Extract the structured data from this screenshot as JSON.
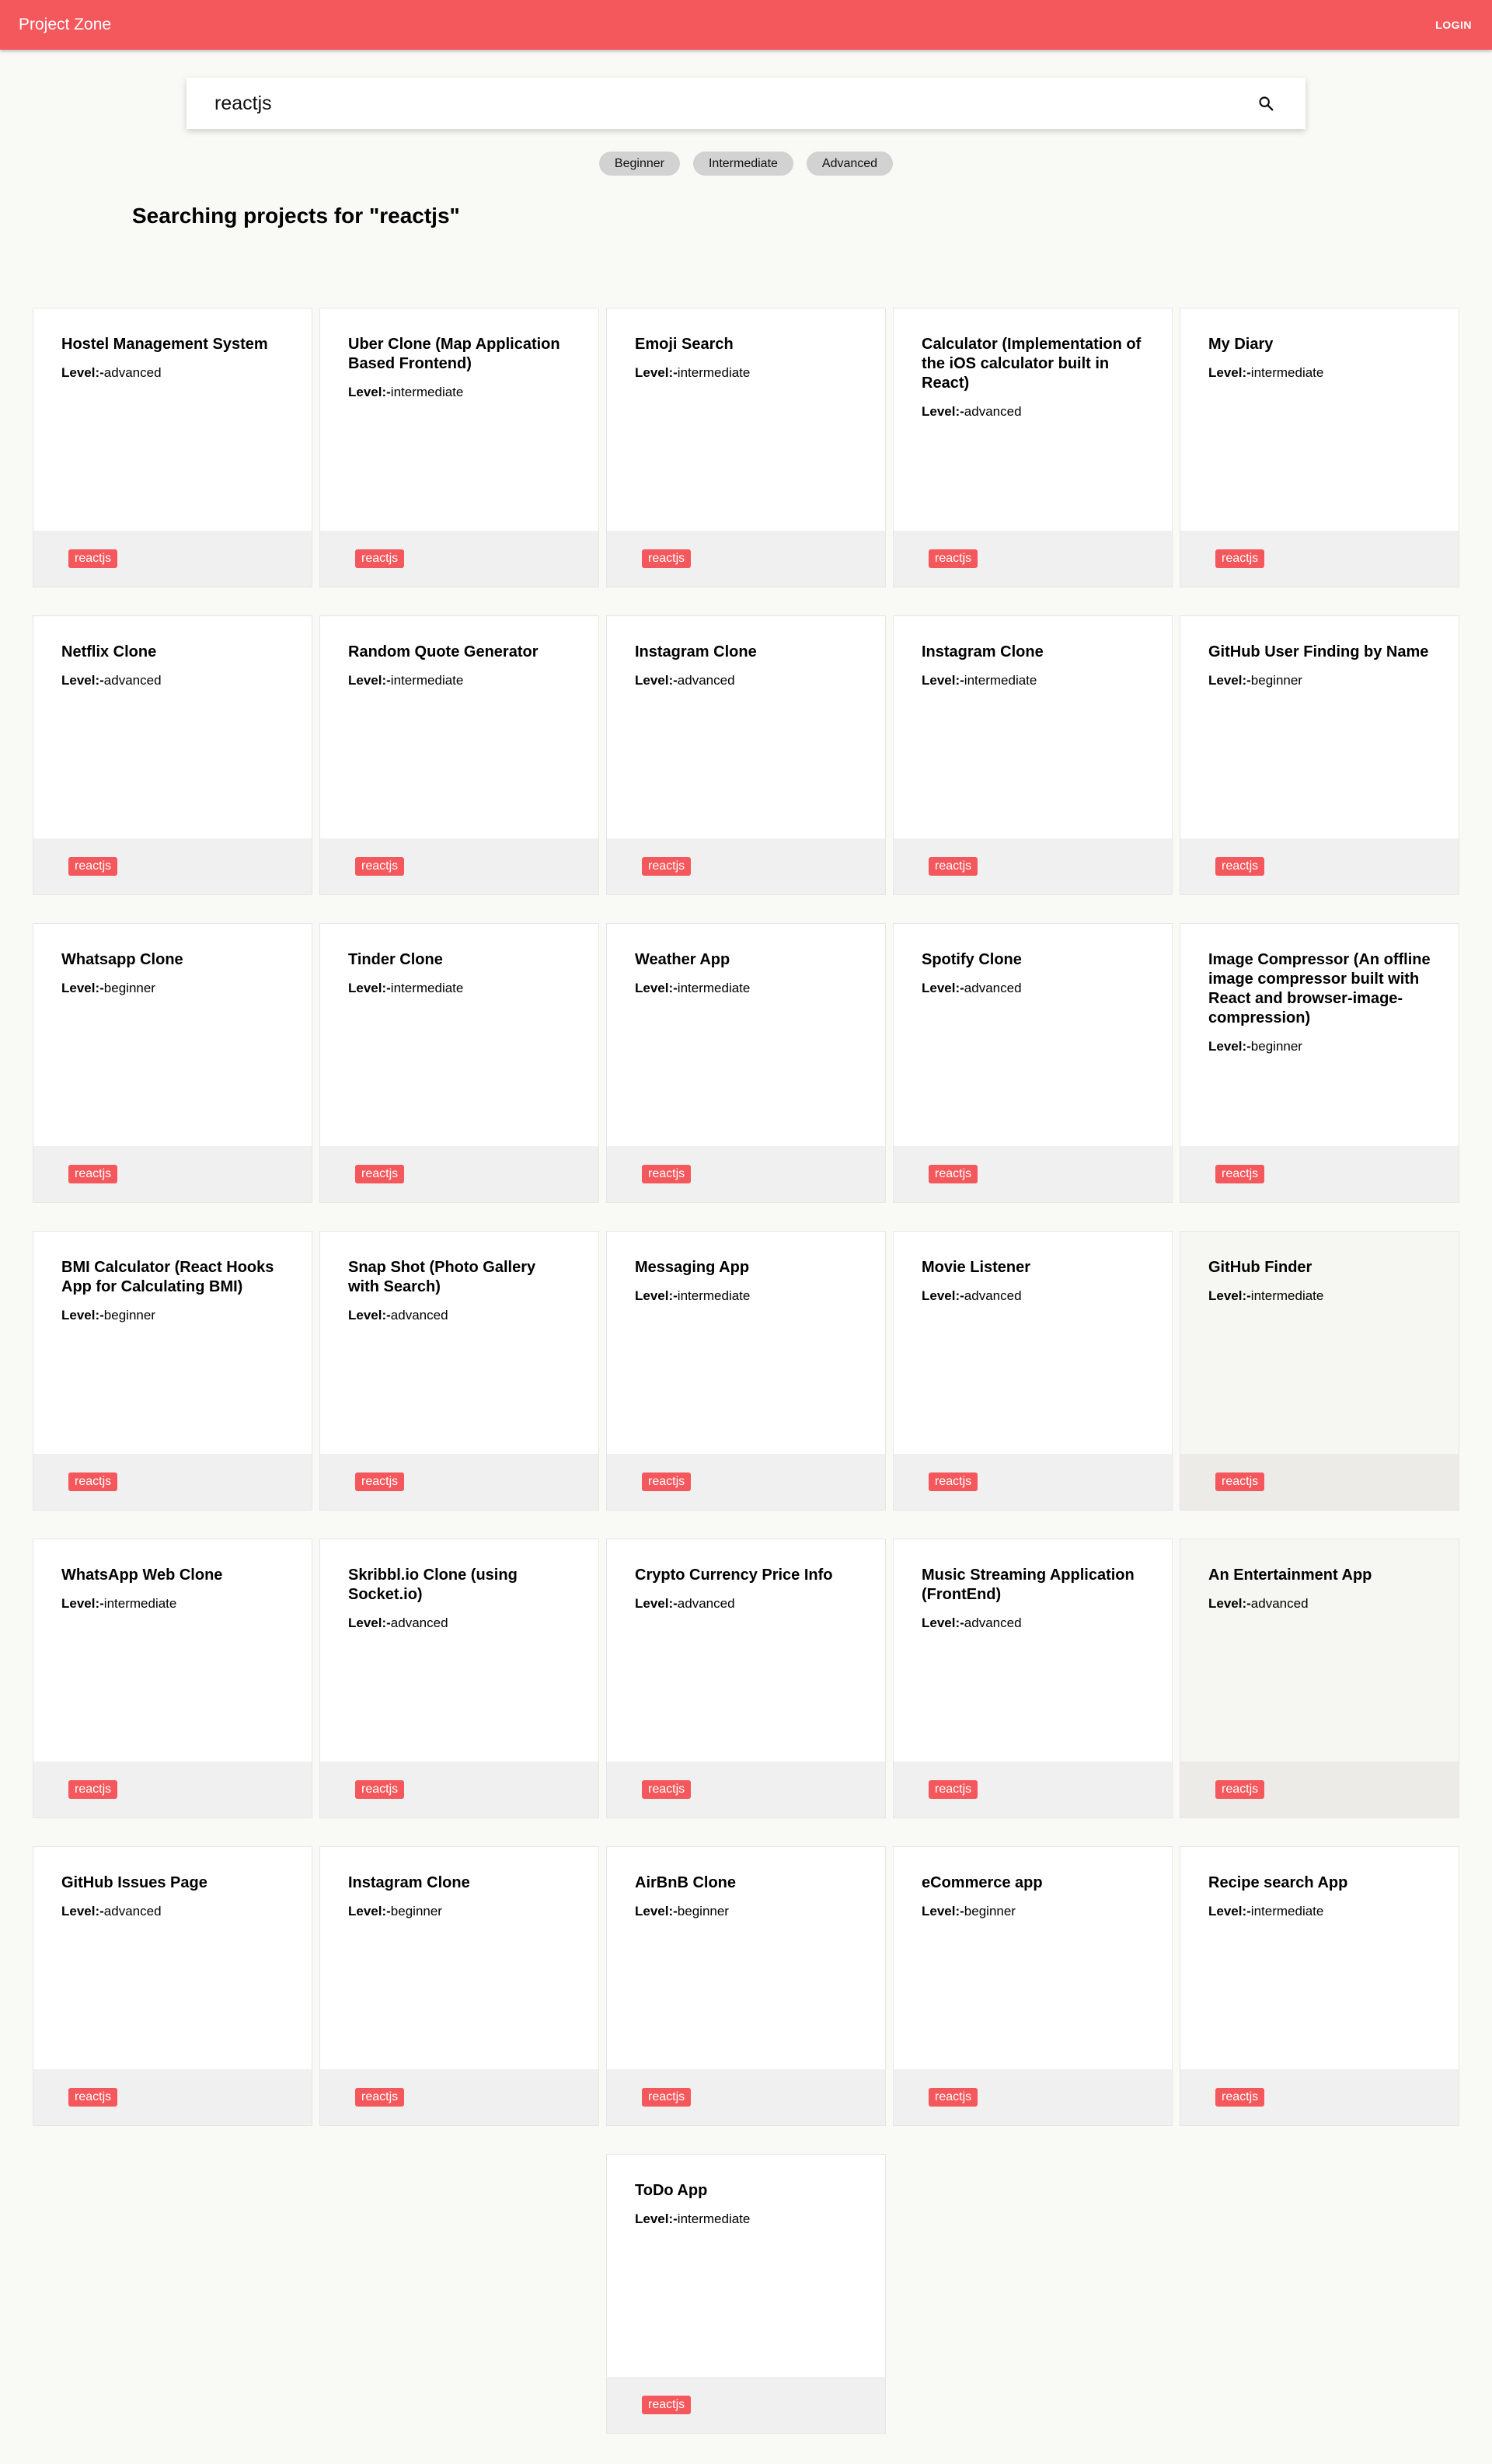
{
  "header": {
    "title": "Project Zone",
    "login_label": "LOGIN"
  },
  "search": {
    "value": "reactjs",
    "placeholder": ""
  },
  "filters": [
    {
      "label": "Beginner"
    },
    {
      "label": "Intermediate"
    },
    {
      "label": "Advanced"
    }
  ],
  "results_heading": "Searching projects for \"reactjs\"",
  "level_label": "Level:-",
  "colors": {
    "brand": "#f4585c",
    "background": "#f9f9f6",
    "chip": "#d2d2d2"
  },
  "icons": {
    "search": "search-icon"
  },
  "projects": [
    {
      "title": "Hostel Management System",
      "level": "advanced",
      "tag": "reactjs"
    },
    {
      "title": "Uber Clone (Map Application Based Frontend)",
      "level": "intermediate",
      "tag": "reactjs"
    },
    {
      "title": "Emoji Search",
      "level": "intermediate",
      "tag": "reactjs"
    },
    {
      "title": "Calculator (Implementation of the iOS calculator built in React)",
      "level": "advanced",
      "tag": "reactjs"
    },
    {
      "title": "My Diary",
      "level": "intermediate",
      "tag": "reactjs"
    },
    {
      "title": "Netflix Clone",
      "level": "advanced",
      "tag": "reactjs"
    },
    {
      "title": "Random Quote Generator",
      "level": "intermediate",
      "tag": "reactjs"
    },
    {
      "title": "Instagram Clone",
      "level": "advanced",
      "tag": "reactjs"
    },
    {
      "title": "Instagram Clone",
      "level": "intermediate",
      "tag": "reactjs"
    },
    {
      "title": "GitHub User Finding by Name",
      "level": "beginner",
      "tag": "reactjs"
    },
    {
      "title": "Whatsapp Clone",
      "level": "beginner",
      "tag": "reactjs"
    },
    {
      "title": "Tinder Clone",
      "level": "intermediate",
      "tag": "reactjs"
    },
    {
      "title": "Weather App",
      "level": "intermediate",
      "tag": "reactjs"
    },
    {
      "title": "Spotify Clone",
      "level": "advanced",
      "tag": "reactjs"
    },
    {
      "title": "Image Compressor (An offline image compressor built with React and browser-image-compression)",
      "level": "beginner",
      "tag": "reactjs"
    },
    {
      "title": "BMI Calculator (React Hooks App for Calculating BMI)",
      "level": "beginner",
      "tag": "reactjs"
    },
    {
      "title": "Snap Shot (Photo Gallery with Search)",
      "level": "advanced",
      "tag": "reactjs"
    },
    {
      "title": "Messaging App",
      "level": "intermediate",
      "tag": "reactjs"
    },
    {
      "title": "Movie Listener",
      "level": "advanced",
      "tag": "reactjs"
    },
    {
      "title": "GitHub Finder",
      "level": "intermediate",
      "tag": "reactjs"
    },
    {
      "title": "WhatsApp Web Clone",
      "level": "intermediate",
      "tag": "reactjs"
    },
    {
      "title": "Skribbl.io Clone (using Socket.io)",
      "level": "advanced",
      "tag": "reactjs"
    },
    {
      "title": "Crypto Currency Price Info",
      "level": "advanced",
      "tag": "reactjs"
    },
    {
      "title": "Music Streaming Application (FrontEnd)",
      "level": "advanced",
      "tag": "reactjs"
    },
    {
      "title": "An Entertainment App",
      "level": "advanced",
      "tag": "reactjs"
    },
    {
      "title": "GitHub Issues Page",
      "level": "advanced",
      "tag": "reactjs"
    },
    {
      "title": "Instagram Clone",
      "level": "beginner",
      "tag": "reactjs"
    },
    {
      "title": "AirBnB Clone",
      "level": "beginner",
      "tag": "reactjs"
    },
    {
      "title": "eCommerce app",
      "level": "beginner",
      "tag": "reactjs"
    },
    {
      "title": "Recipe search App",
      "level": "intermediate",
      "tag": "reactjs"
    },
    {
      "title": "ToDo App",
      "level": "intermediate",
      "tag": "reactjs"
    }
  ]
}
